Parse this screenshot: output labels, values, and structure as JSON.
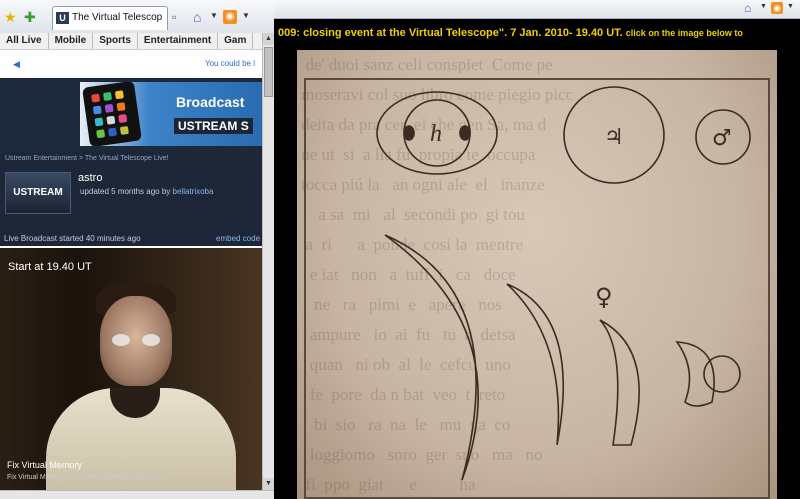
{
  "left_window": {
    "tab_title": "The Virtual Telescope",
    "nav_items": [
      "All Live",
      "Mobile",
      "Sports",
      "Entertainment",
      "Gam"
    ],
    "notice_text": "You could be l",
    "banner": {
      "title": "Broadcast",
      "brand": "USTREAM",
      "brand_suffix": "S"
    },
    "channel": {
      "breadcrumb": "Ustream Entertainment > The Virtual Telescope Live!",
      "logo_text": "USTREAM",
      "name": "astro",
      "updated_prefix": "updated 5 months ago by",
      "updated_user": "bellatrixoba",
      "live_started": "Live Broadcast started 40 minutes ago",
      "embed_link": "embed code"
    },
    "video": {
      "title": "Start at 19.40 UT",
      "caption": "Fix Virtual Memory",
      "caption_sub": "Fix Virtual Memory in ... Free Download 100% Scan"
    }
  },
  "right_window": {
    "marquee": "009: closing event at the Virtual Telescope\". 7 Jan. 2010- 19.40 UT.",
    "marquee_sub": "click on the image below to",
    "drawing_symbols": {
      "saturn": "h",
      "jupiter": "♃",
      "mars": "♂",
      "venus": "♀"
    }
  },
  "colors": {
    "marquee": "#f0d000",
    "ustream_dark": "#1d2738",
    "link": "#2a6bd1"
  }
}
